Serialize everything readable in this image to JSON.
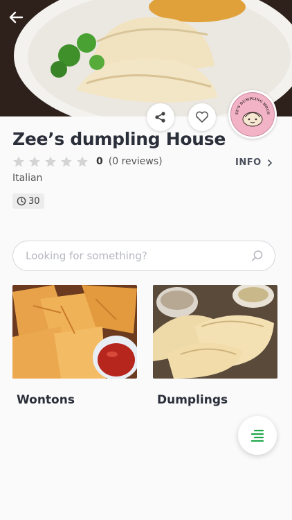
{
  "restaurant": {
    "name": "Zee’s dumpling House",
    "rating_value": "0",
    "reviews_label": "(0 reviews)",
    "cuisine": "Italian",
    "prep_time": "30",
    "info_label": "INFO",
    "logo_text": "ZEE'S DUMPLING HOUSE"
  },
  "search": {
    "placeholder": "Looking for something?",
    "value": ""
  },
  "categories": [
    {
      "label": "Wontons"
    },
    {
      "label": "Dumplings"
    }
  ],
  "colors": {
    "accent": "#1fa64a",
    "title": "#2b2f3a",
    "star_empty": "#d4d4d4"
  }
}
